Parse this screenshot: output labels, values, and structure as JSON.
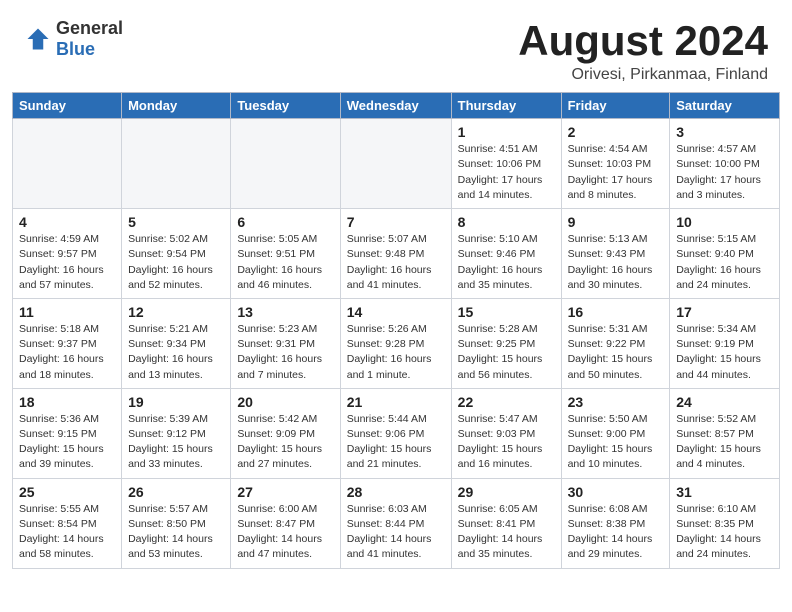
{
  "logo": {
    "general": "General",
    "blue": "Blue"
  },
  "title": "August 2024",
  "subtitle": "Orivesi, Pirkanmaa, Finland",
  "days_of_week": [
    "Sunday",
    "Monday",
    "Tuesday",
    "Wednesday",
    "Thursday",
    "Friday",
    "Saturday"
  ],
  "weeks": [
    [
      {
        "day": "",
        "info": ""
      },
      {
        "day": "",
        "info": ""
      },
      {
        "day": "",
        "info": ""
      },
      {
        "day": "",
        "info": ""
      },
      {
        "day": "1",
        "info": "Sunrise: 4:51 AM\nSunset: 10:06 PM\nDaylight: 17 hours\nand 14 minutes."
      },
      {
        "day": "2",
        "info": "Sunrise: 4:54 AM\nSunset: 10:03 PM\nDaylight: 17 hours\nand 8 minutes."
      },
      {
        "day": "3",
        "info": "Sunrise: 4:57 AM\nSunset: 10:00 PM\nDaylight: 17 hours\nand 3 minutes."
      }
    ],
    [
      {
        "day": "4",
        "info": "Sunrise: 4:59 AM\nSunset: 9:57 PM\nDaylight: 16 hours\nand 57 minutes."
      },
      {
        "day": "5",
        "info": "Sunrise: 5:02 AM\nSunset: 9:54 PM\nDaylight: 16 hours\nand 52 minutes."
      },
      {
        "day": "6",
        "info": "Sunrise: 5:05 AM\nSunset: 9:51 PM\nDaylight: 16 hours\nand 46 minutes."
      },
      {
        "day": "7",
        "info": "Sunrise: 5:07 AM\nSunset: 9:48 PM\nDaylight: 16 hours\nand 41 minutes."
      },
      {
        "day": "8",
        "info": "Sunrise: 5:10 AM\nSunset: 9:46 PM\nDaylight: 16 hours\nand 35 minutes."
      },
      {
        "day": "9",
        "info": "Sunrise: 5:13 AM\nSunset: 9:43 PM\nDaylight: 16 hours\nand 30 minutes."
      },
      {
        "day": "10",
        "info": "Sunrise: 5:15 AM\nSunset: 9:40 PM\nDaylight: 16 hours\nand 24 minutes."
      }
    ],
    [
      {
        "day": "11",
        "info": "Sunrise: 5:18 AM\nSunset: 9:37 PM\nDaylight: 16 hours\nand 18 minutes."
      },
      {
        "day": "12",
        "info": "Sunrise: 5:21 AM\nSunset: 9:34 PM\nDaylight: 16 hours\nand 13 minutes."
      },
      {
        "day": "13",
        "info": "Sunrise: 5:23 AM\nSunset: 9:31 PM\nDaylight: 16 hours\nand 7 minutes."
      },
      {
        "day": "14",
        "info": "Sunrise: 5:26 AM\nSunset: 9:28 PM\nDaylight: 16 hours\nand 1 minute."
      },
      {
        "day": "15",
        "info": "Sunrise: 5:28 AM\nSunset: 9:25 PM\nDaylight: 15 hours\nand 56 minutes."
      },
      {
        "day": "16",
        "info": "Sunrise: 5:31 AM\nSunset: 9:22 PM\nDaylight: 15 hours\nand 50 minutes."
      },
      {
        "day": "17",
        "info": "Sunrise: 5:34 AM\nSunset: 9:19 PM\nDaylight: 15 hours\nand 44 minutes."
      }
    ],
    [
      {
        "day": "18",
        "info": "Sunrise: 5:36 AM\nSunset: 9:15 PM\nDaylight: 15 hours\nand 39 minutes."
      },
      {
        "day": "19",
        "info": "Sunrise: 5:39 AM\nSunset: 9:12 PM\nDaylight: 15 hours\nand 33 minutes."
      },
      {
        "day": "20",
        "info": "Sunrise: 5:42 AM\nSunset: 9:09 PM\nDaylight: 15 hours\nand 27 minutes."
      },
      {
        "day": "21",
        "info": "Sunrise: 5:44 AM\nSunset: 9:06 PM\nDaylight: 15 hours\nand 21 minutes."
      },
      {
        "day": "22",
        "info": "Sunrise: 5:47 AM\nSunset: 9:03 PM\nDaylight: 15 hours\nand 16 minutes."
      },
      {
        "day": "23",
        "info": "Sunrise: 5:50 AM\nSunset: 9:00 PM\nDaylight: 15 hours\nand 10 minutes."
      },
      {
        "day": "24",
        "info": "Sunrise: 5:52 AM\nSunset: 8:57 PM\nDaylight: 15 hours\nand 4 minutes."
      }
    ],
    [
      {
        "day": "25",
        "info": "Sunrise: 5:55 AM\nSunset: 8:54 PM\nDaylight: 14 hours\nand 58 minutes."
      },
      {
        "day": "26",
        "info": "Sunrise: 5:57 AM\nSunset: 8:50 PM\nDaylight: 14 hours\nand 53 minutes."
      },
      {
        "day": "27",
        "info": "Sunrise: 6:00 AM\nSunset: 8:47 PM\nDaylight: 14 hours\nand 47 minutes."
      },
      {
        "day": "28",
        "info": "Sunrise: 6:03 AM\nSunset: 8:44 PM\nDaylight: 14 hours\nand 41 minutes."
      },
      {
        "day": "29",
        "info": "Sunrise: 6:05 AM\nSunset: 8:41 PM\nDaylight: 14 hours\nand 35 minutes."
      },
      {
        "day": "30",
        "info": "Sunrise: 6:08 AM\nSunset: 8:38 PM\nDaylight: 14 hours\nand 29 minutes."
      },
      {
        "day": "31",
        "info": "Sunrise: 6:10 AM\nSunset: 8:35 PM\nDaylight: 14 hours\nand 24 minutes."
      }
    ]
  ]
}
